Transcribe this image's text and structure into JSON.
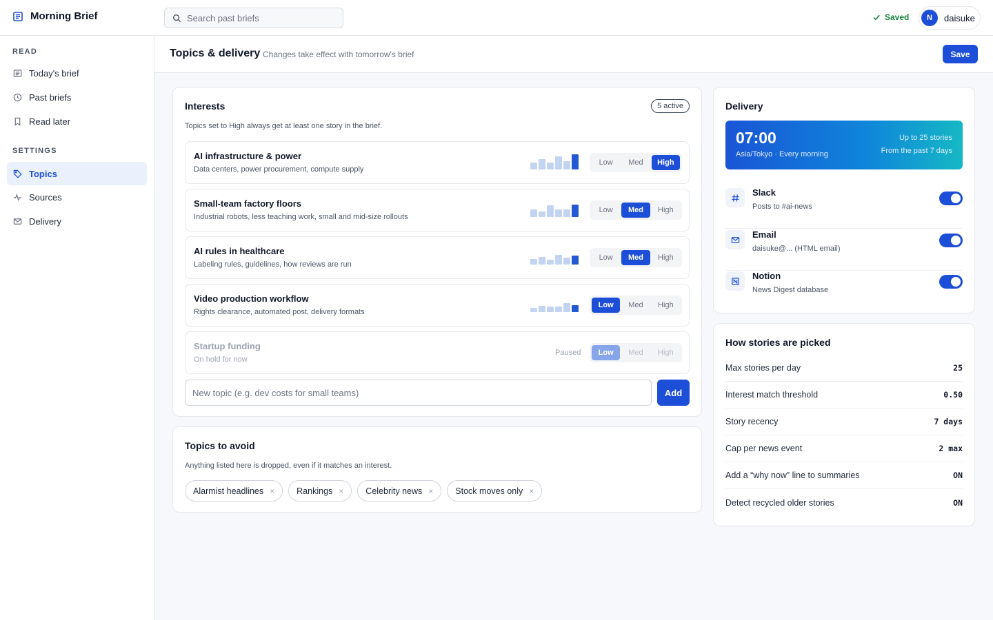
{
  "app": {
    "title": "Morning Brief"
  },
  "search": {
    "placeholder": "Search past briefs"
  },
  "status": {
    "saved_label": "Saved"
  },
  "user": {
    "initial": "N",
    "name": "daisuke"
  },
  "sidebar": {
    "read_heading": "READ",
    "read_items": [
      {
        "label": "Today's brief",
        "icon": "newspaper-icon"
      },
      {
        "label": "Past briefs",
        "icon": "clock-icon"
      },
      {
        "label": "Read later",
        "icon": "bookmark-icon"
      }
    ],
    "settings_heading": "SETTINGS",
    "settings_items": [
      {
        "label": "Topics",
        "icon": "tag-icon",
        "active": true
      },
      {
        "label": "Sources",
        "icon": "activity-icon"
      },
      {
        "label": "Delivery",
        "icon": "mail-icon"
      }
    ]
  },
  "page": {
    "title": "Topics & delivery",
    "subtitle": "Changes take effect with tomorrow's brief",
    "save_label": "Save"
  },
  "interests": {
    "title": "Interests",
    "badge": "5 active",
    "description": "Topics set to High always get at least one story in the brief.",
    "level_labels": [
      "Low",
      "Med",
      "High"
    ],
    "paused_label": "Paused",
    "topics": [
      {
        "name": "AI infrastructure & power",
        "description": "Data centers, power procurement, compute supply",
        "level": "High",
        "paused": false,
        "trend": [
          0.45,
          0.7,
          0.45,
          0.85,
          0.55,
          1.0
        ]
      },
      {
        "name": "Small-team factory floors",
        "description": "Industrial robots, less teaching work, small and mid-size rollouts",
        "level": "Med",
        "paused": false,
        "trend": [
          0.5,
          0.35,
          0.75,
          0.5,
          0.5,
          0.8
        ]
      },
      {
        "name": "AI rules in healthcare",
        "description": "Labeling rules, guidelines, how reviews are run",
        "level": "Med",
        "paused": false,
        "trend": [
          0.35,
          0.5,
          0.3,
          0.65,
          0.45,
          0.6
        ]
      },
      {
        "name": "Video production workflow",
        "description": "Rights clearance, automated post, delivery formats",
        "level": "Low",
        "paused": false,
        "trend": [
          0.25,
          0.4,
          0.35,
          0.35,
          0.6,
          0.45
        ]
      },
      {
        "name": "Startup funding",
        "description": "On hold for now",
        "level": "Low",
        "paused": true,
        "trend": []
      }
    ],
    "new_topic_placeholder": "New topic (e.g. dev costs for small teams)",
    "add_label": "Add"
  },
  "avoid": {
    "title": "Topics to avoid",
    "description": "Anything listed here is dropped, even if it matches an interest.",
    "chips": [
      "Alarmist headlines",
      "Rankings",
      "Celebrity news",
      "Stock moves only"
    ],
    "remove_glyph": "×"
  },
  "delivery": {
    "title": "Delivery",
    "time": "07:00",
    "schedule": "Asia/Tokyo · Every morning",
    "limit": "Up to 25 stories",
    "window": "From the past 7 days",
    "channels": [
      {
        "name": "Slack",
        "description": "Posts to #ai-news",
        "icon": "hash-icon",
        "enabled": true
      },
      {
        "name": "Email",
        "description": "daisuke@... (HTML email)",
        "icon": "mail-icon",
        "enabled": true
      },
      {
        "name": "Notion",
        "description": "News Digest database",
        "icon": "notion-icon",
        "enabled": true
      }
    ]
  },
  "picking": {
    "title": "How stories are picked",
    "rules": [
      {
        "label": "Max stories per day",
        "value": "25"
      },
      {
        "label": "Interest match threshold",
        "value": "0.50"
      },
      {
        "label": "Story recency",
        "value": "7 days"
      },
      {
        "label": "Cap per news event",
        "value": "2 max"
      },
      {
        "label": "Add a “why now” line to summaries",
        "value": "ON"
      },
      {
        "label": "Detect recycled older stories",
        "value": "ON"
      }
    ]
  },
  "colors": {
    "accent": "#1d4ed8",
    "saved": "#15803d",
    "bar_light": "#c3d3f2",
    "bar_dark": "#2558d4"
  }
}
